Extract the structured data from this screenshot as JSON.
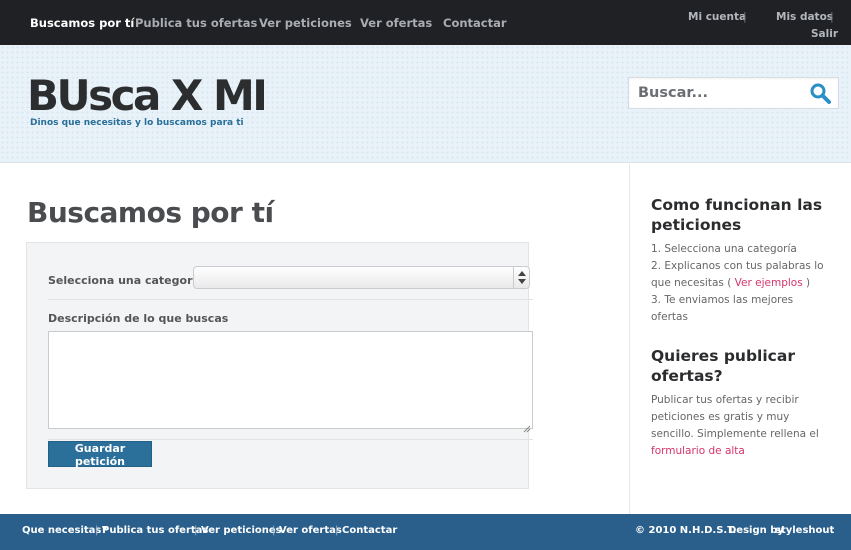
{
  "nav": {
    "items": [
      "Buscamos por tí",
      "Publica tus ofertas",
      "Ver peticiones",
      "Ver ofertas",
      "Contactar"
    ],
    "account": {
      "my_account": "Mi cuenta",
      "my_data": "Mis datos",
      "logout": "Salir",
      "separator": "|"
    }
  },
  "header": {
    "logo": "BUsca X MI",
    "tagline": "Dinos que necesitas y lo buscamos para ti",
    "search_placeholder": "Buscar..."
  },
  "main": {
    "title": "Buscamos por tí",
    "category_label": "Selecciona una categoría",
    "category_value": "",
    "description_label": "Descripción de lo que buscas",
    "description_value": "",
    "submit_label": "Guardar petición"
  },
  "sidebar": {
    "how_title_1": "Como funcionan las",
    "how_title_2": "peticiones",
    "step1": "1. Selecciona una categoría",
    "step2a": "2. Explicanos con tus palabras lo",
    "step2b": "que necesitas (",
    "step2_link": "Ver ejemplos",
    "step2c": ")",
    "step3a": "3. Te enviamos las mejores",
    "step3b": "ofertas",
    "publish_title_1": "Quieres publicar",
    "publish_title_2": "ofertas?",
    "p1": "Publicar tus ofertas y recibir",
    "p2": "peticiones es gratis y muy",
    "p3": "sencillo. Simplemente rellena el",
    "p_link": "formulario de alta"
  },
  "footer": {
    "links": [
      "Que necesitas?",
      "Publica tus ofertas",
      "Ver peticiones",
      "Ver ofertas",
      "Contactar"
    ],
    "separator": "|",
    "copyright": "© 2010 N.H.D.S.T.",
    "design_by": "Design by",
    "designer": "styleshout"
  },
  "colors": {
    "nav_bg": "#1f2124",
    "footer_bg": "#2a5f8c",
    "accent_blue": "#2b6f9b",
    "link_pink": "#d6336c"
  }
}
